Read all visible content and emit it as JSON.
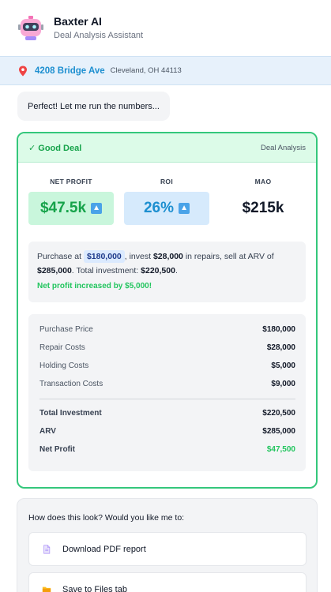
{
  "header": {
    "title": "Baxter AI",
    "subtitle": "Deal Analysis Assistant",
    "avatar_icon": "robot-icon"
  },
  "address": {
    "icon": "map-pin-icon",
    "street": "4208 Bridge Ave",
    "city": "Cleveland, OH 44113"
  },
  "message": {
    "text": "Perfect! Let me run the numbers..."
  },
  "deal_card": {
    "status": "✓ Good Deal",
    "label": "Deal Analysis",
    "accent_color": "#34c77b",
    "metrics": [
      {
        "label": "NET PROFIT",
        "value": "$47.5k",
        "trend": "up"
      },
      {
        "label": "ROI",
        "value": "26%",
        "trend": "up"
      },
      {
        "label": "MAO",
        "value": "$215k"
      }
    ],
    "summary": {
      "t1": "Purchase at ",
      "purchase": "$180,000",
      "t2": ", invest ",
      "repairs": "$28,000",
      "t3": " in repairs, sell at ARV of ",
      "arv": "$285,000",
      "t4": ". Total investment: ",
      "total": "$220,500",
      "t5": ".",
      "note": "Net profit increased by $5,000!"
    },
    "breakdown": {
      "costs": [
        {
          "label": "Purchase Price",
          "value": "$180,000"
        },
        {
          "label": "Repair Costs",
          "value": "$28,000"
        },
        {
          "label": "Holding Costs",
          "value": "$5,000"
        },
        {
          "label": "Transaction Costs",
          "value": "$9,000"
        }
      ],
      "totals": [
        {
          "label": "Total Investment",
          "value": "$220,500"
        },
        {
          "label": "ARV",
          "value": "$285,000"
        },
        {
          "label": "Net Profit",
          "value": "$47,500"
        }
      ]
    }
  },
  "followup": {
    "question": "How does this look? Would you like me to:",
    "options": [
      {
        "label": "Download PDF report",
        "icon": "document-icon"
      },
      {
        "label": "Save to Files tab",
        "icon": "folder-icon"
      }
    ]
  }
}
